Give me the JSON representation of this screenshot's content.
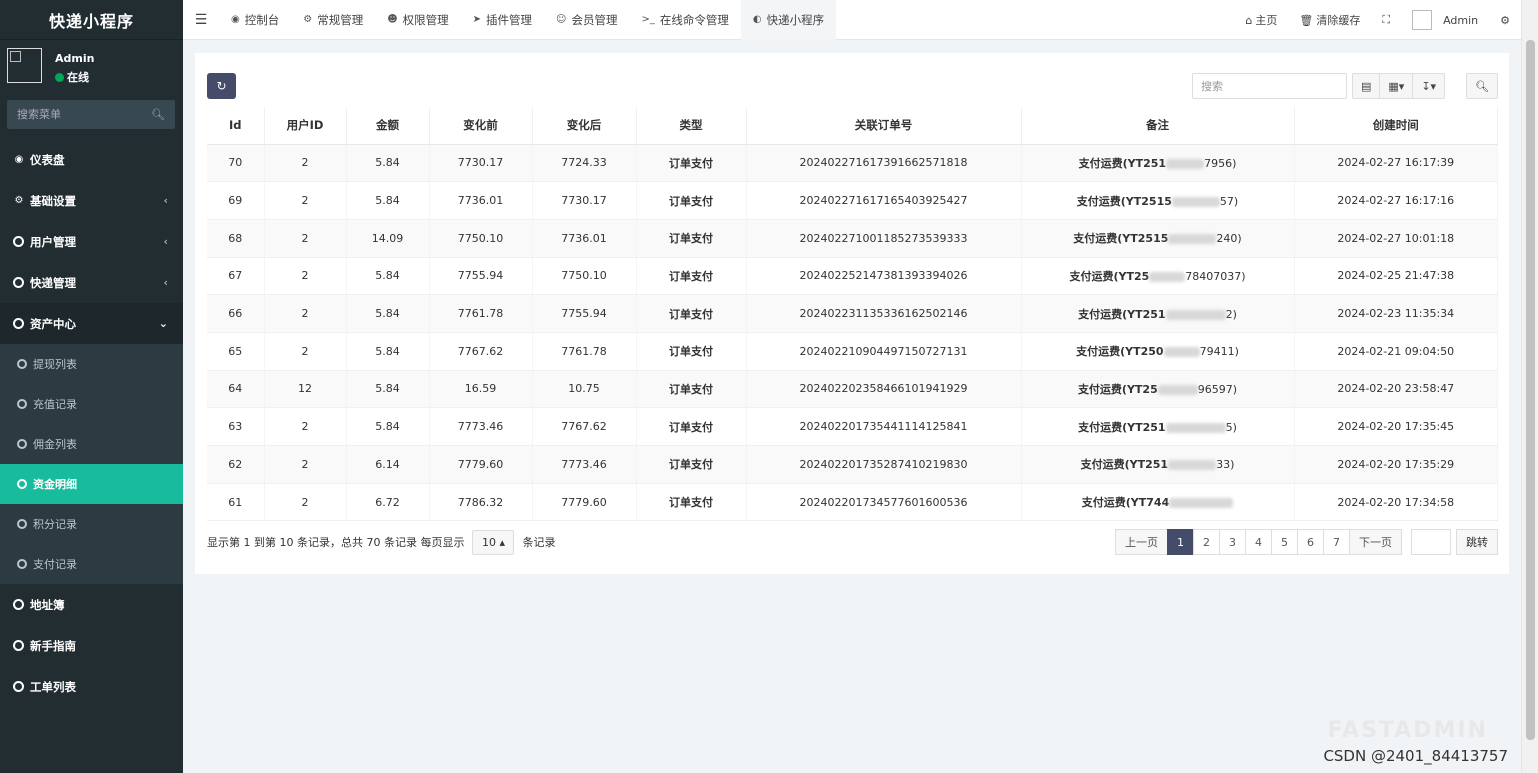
{
  "app": {
    "brand": "快递小程序"
  },
  "user": {
    "name": "Admin",
    "status": "在线"
  },
  "sidebar": {
    "search_placeholder": "搜索菜单",
    "items": [
      {
        "label": "仪表盘",
        "icon": "dashboard-icon"
      },
      {
        "label": "基础设置",
        "icon": "cogs-icon"
      },
      {
        "label": "用户管理",
        "icon": "circle-icon"
      },
      {
        "label": "快递管理",
        "icon": "circle-icon"
      },
      {
        "label": "资产中心",
        "icon": "circle-icon"
      }
    ],
    "subitems": [
      "提现列表",
      "充值记录",
      "佣金列表",
      "资金明细",
      "积分记录",
      "支付记录"
    ],
    "bottom_items": [
      "地址簿",
      "新手指南",
      "工单列表"
    ]
  },
  "topbar": {
    "tabs": [
      "控制台",
      "常规管理",
      "权限管理",
      "插件管理",
      "会员管理",
      "在线命令管理",
      "快递小程序"
    ],
    "home": "主页",
    "clear_cache": "清除缓存",
    "admin": "Admin"
  },
  "toolbar": {
    "search_placeholder": "搜索"
  },
  "table": {
    "headers": [
      "Id",
      "用户ID",
      "金额",
      "变化前",
      "变化后",
      "类型",
      "关联订单号",
      "备注",
      "创建时间"
    ],
    "rows": [
      [
        "70",
        "2",
        "5.84",
        "7730.17",
        "7724.33",
        "订单支付",
        "20240227161739166257181​8",
        "支付运费(YT251",
        "7956)",
        "2024-02-27 16:17:39"
      ],
      [
        "69",
        "2",
        "5.84",
        "7736.01",
        "7730.17",
        "订单支付",
        "2024022716171654039254​27",
        "支付运费(YT2515",
        "57)",
        "2024-02-27 16:17:16"
      ],
      [
        "68",
        "2",
        "14.09",
        "7750.10",
        "7736.01",
        "订单支付",
        "202402271001185273539333",
        "支付运费(YT2515",
        "240)",
        "2024-02-27 10:01:18"
      ],
      [
        "67",
        "2",
        "5.84",
        "7755.94",
        "7750.10",
        "订单支付",
        "202402252147381393394026",
        "支付运费(YT25",
        "78407037)",
        "2024-02-25 21:47:38"
      ],
      [
        "66",
        "2",
        "5.84",
        "7761.78",
        "7755.94",
        "订单支付",
        "202402231135336162502146",
        "支付运费(YT251",
        "2)",
        "2024-02-23 11:35:34"
      ],
      [
        "65",
        "2",
        "5.84",
        "7767.62",
        "7761.78",
        "订单支付",
        "202402210904497150727131",
        "支付运费(YT250",
        "79411)",
        "2024-02-21 09:04:50"
      ],
      [
        "64",
        "12",
        "5.84",
        "16.59",
        "10.75",
        "订单支付",
        "202402202358466101941929",
        "支付运费(YT25",
        "96597)",
        "2024-02-20 23:58:47"
      ],
      [
        "63",
        "2",
        "5.84",
        "7773.46",
        "7767.62",
        "订单支付",
        "202402201735441114125841",
        "支付运费(YT251",
        "5)",
        "2024-02-20 17:35:45"
      ],
      [
        "62",
        "2",
        "6.14",
        "7779.60",
        "7773.46",
        "订单支付",
        "202402201735287410219830",
        "支付运费(YT251",
        "33)",
        "2024-02-20 17:35:29"
      ],
      [
        "61",
        "2",
        "6.72",
        "7786.32",
        "7779.60",
        "订单支付",
        "202402201734577601600536",
        "支付运费(YT744",
        "",
        "2024-02-20 17:34:58"
      ]
    ]
  },
  "footer": {
    "info_prefix": "显示第 1 到第 10 条记录，总共 70 条记录 每页显示",
    "page_size": "10",
    "info_suffix": "条记录",
    "prev": "上一页",
    "pages": [
      "1",
      "2",
      "3",
      "4",
      "5",
      "6",
      "7"
    ],
    "next": "下一页",
    "go": "跳转"
  },
  "watermark": "CSDN @2401_84413757",
  "watermark_bg": "FASTADMIN"
}
